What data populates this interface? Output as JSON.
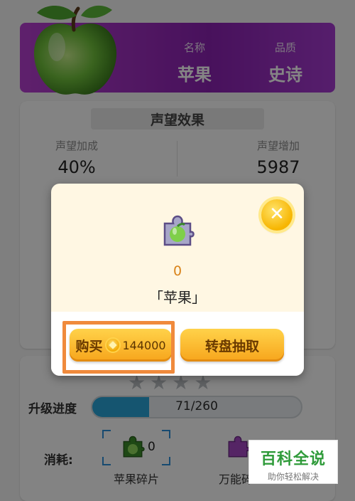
{
  "item": {
    "name_label": "名称",
    "name": "苹果",
    "quality_label": "品质",
    "quality": "史诗",
    "banner_color": "#9b2fc4"
  },
  "prestige": {
    "title": "声望效果",
    "bonus_label": "声望加成",
    "bonus_value": "40%",
    "increase_label": "声望增加",
    "increase_value": "5987"
  },
  "upgrade": {
    "stars_total": 4,
    "progress_label": "升级进度",
    "progress_text": "71/260",
    "progress_current": 71,
    "progress_max": 260,
    "cost_label": "消耗:",
    "fragment_name": "苹果碎片",
    "fragment_count": "0",
    "universal_name": "万能碎"
  },
  "modal": {
    "count": "0",
    "name": "「苹果」",
    "close_icon": "close-icon",
    "buy_label": "购买",
    "buy_price": "144000",
    "spin_label": "转盘抽取",
    "accent_color": "#f7a51c"
  },
  "watermark": {
    "main": "百科全说",
    "sub": "助你轻松解决"
  }
}
